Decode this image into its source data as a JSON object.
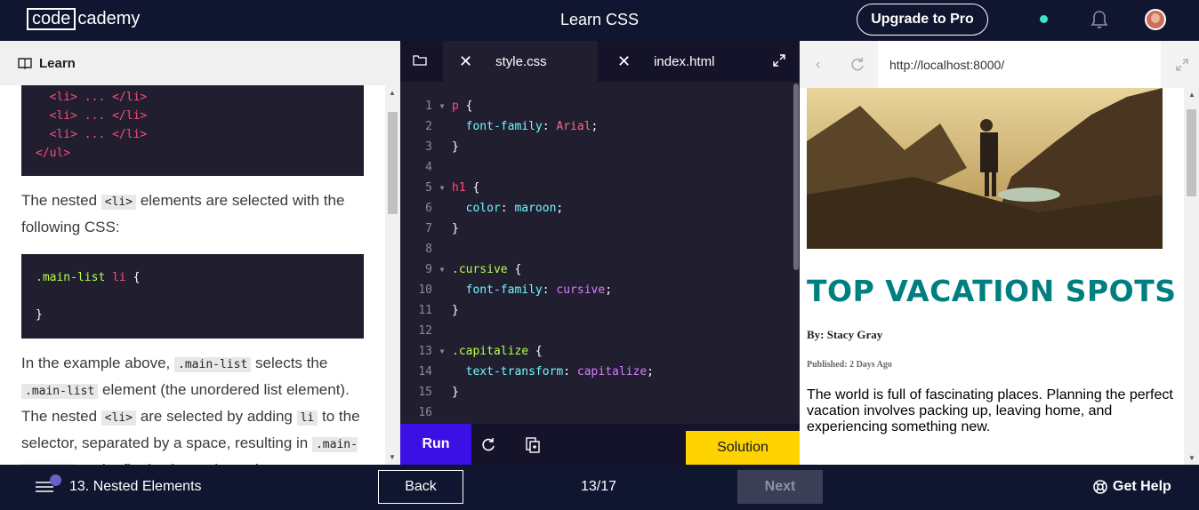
{
  "header": {
    "logo_box": "code",
    "logo_rest": "cademy",
    "title": "Learn CSS",
    "upgrade_label": "Upgrade to Pro"
  },
  "learn": {
    "header_label": "Learn",
    "code_a": [
      "<li> ... </li>",
      "<li> ... </li>",
      "<li> ... </li>",
      "</ul>"
    ],
    "para1_before": "The nested ",
    "para1_code": "<li>",
    "para1_after": " elements are selected with the following CSS:",
    "code_b_line1_cls": ".main-list",
    "code_b_line1_sel": "li",
    "code_b_line1_brace": "{",
    "code_b_line2": "}",
    "para2": [
      {
        "t": "In the example above, "
      },
      {
        "c": ".main-list"
      },
      {
        "t": " selects the "
      },
      {
        "c": ".main-list"
      },
      {
        "t": " element (the unordered list element). The nested "
      },
      {
        "c": "<li>"
      },
      {
        "t": " are selected by adding "
      },
      {
        "c": "li"
      },
      {
        "t": " to the selector, separated by a space, resulting in "
      },
      {
        "c": ".main-list li"
      },
      {
        "t": " as the final selector (note the"
      }
    ]
  },
  "editor": {
    "tabs": [
      {
        "label": "style.css",
        "active": true
      },
      {
        "label": "index.html",
        "active": false
      }
    ],
    "lines": [
      {
        "n": "1",
        "fold": true,
        "parts": [
          {
            "c": "c-sel",
            "t": "p"
          },
          {
            "c": "",
            "t": " {"
          }
        ]
      },
      {
        "n": "2",
        "fold": false,
        "parts": [
          {
            "c": "",
            "t": "  "
          },
          {
            "c": "c-prop",
            "t": "font-family"
          },
          {
            "c": "",
            "t": ": "
          },
          {
            "c": "c-str",
            "t": "Arial"
          },
          {
            "c": "",
            "t": ";"
          }
        ]
      },
      {
        "n": "3",
        "fold": false,
        "parts": [
          {
            "c": "",
            "t": "}"
          }
        ]
      },
      {
        "n": "4",
        "fold": false,
        "parts": []
      },
      {
        "n": "5",
        "fold": true,
        "parts": [
          {
            "c": "c-sel",
            "t": "h1"
          },
          {
            "c": "",
            "t": " {"
          }
        ]
      },
      {
        "n": "6",
        "fold": false,
        "parts": [
          {
            "c": "",
            "t": "  "
          },
          {
            "c": "c-prop",
            "t": "color"
          },
          {
            "c": "",
            "t": ": "
          },
          {
            "c": "c-prop",
            "t": "maroon"
          },
          {
            "c": "",
            "t": ";"
          }
        ]
      },
      {
        "n": "7",
        "fold": false,
        "parts": [
          {
            "c": "",
            "t": "}"
          }
        ]
      },
      {
        "n": "8",
        "fold": false,
        "parts": []
      },
      {
        "n": "9",
        "fold": true,
        "parts": [
          {
            "c": "c-cls",
            "t": ".cursive"
          },
          {
            "c": "",
            "t": " {"
          }
        ]
      },
      {
        "n": "10",
        "fold": false,
        "parts": [
          {
            "c": "",
            "t": "  "
          },
          {
            "c": "c-prop",
            "t": "font-family"
          },
          {
            "c": "",
            "t": ": "
          },
          {
            "c": "c-val",
            "t": "cursive"
          },
          {
            "c": "",
            "t": ";"
          }
        ]
      },
      {
        "n": "11",
        "fold": false,
        "parts": [
          {
            "c": "",
            "t": "}"
          }
        ]
      },
      {
        "n": "12",
        "fold": false,
        "parts": []
      },
      {
        "n": "13",
        "fold": true,
        "parts": [
          {
            "c": "c-cls",
            "t": ".capitalize"
          },
          {
            "c": "",
            "t": " {"
          }
        ]
      },
      {
        "n": "14",
        "fold": false,
        "parts": [
          {
            "c": "",
            "t": "  "
          },
          {
            "c": "c-prop",
            "t": "text-transform"
          },
          {
            "c": "",
            "t": ": "
          },
          {
            "c": "c-val",
            "t": "capitalize"
          },
          {
            "c": "",
            "t": ";"
          }
        ]
      },
      {
        "n": "15",
        "fold": false,
        "parts": [
          {
            "c": "",
            "t": "}"
          }
        ]
      },
      {
        "n": "16",
        "fold": false,
        "parts": []
      }
    ],
    "run_label": "Run",
    "solution_label": "Solution"
  },
  "browser": {
    "url": "http://localhost:8000/",
    "title": "TOP VACATION SPOTS",
    "byline": "By: Stacy Gray",
    "published": "Published: 2 Days Ago",
    "paragraph": "The world is full of fascinating places. Planning the perfect vacation involves packing up, leaving home, and experiencing something new."
  },
  "footer": {
    "lesson": "13. Nested Elements",
    "back_label": "Back",
    "progress": "13/17",
    "next_label": "Next",
    "help_label": "Get Help"
  },
  "colors": {
    "navy": "#10162f",
    "run_purple": "#3a10e5",
    "solution_yellow": "#ffd300",
    "title_teal": "#007f80"
  },
  "icons": [
    "book-icon",
    "folder-icon",
    "close-icon",
    "expand-icon",
    "back-arrow-icon",
    "refresh-icon",
    "reset-icon",
    "copy-icon",
    "bell-icon",
    "menu-icon",
    "help-icon"
  ]
}
